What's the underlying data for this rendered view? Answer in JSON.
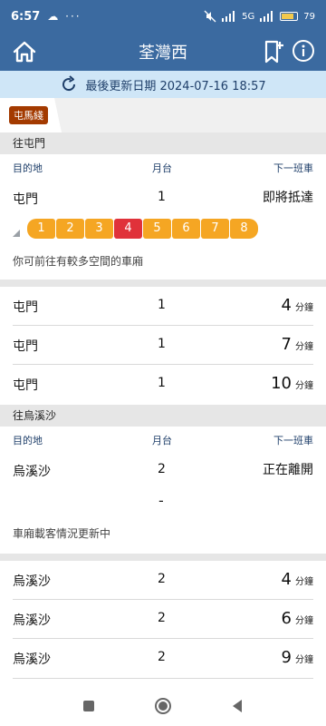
{
  "status_bar": {
    "time": "6:57",
    "left_icons": "☁ ···",
    "signal_text": "5G",
    "battery_text": "79"
  },
  "header": {
    "title": "荃灣西",
    "home_icon": "home-icon",
    "bookmark_icon": "bookmark-add-icon",
    "info_icon": "info-icon"
  },
  "update_bar": {
    "label": "最後更新日期 2024-07-16 18:57",
    "icon": "refresh-icon"
  },
  "line_tab": {
    "label": "屯馬綫",
    "color": "#a33a00"
  },
  "columns": {
    "destination": "目的地",
    "platform": "月台",
    "next_train": "下一班車"
  },
  "sections": [
    {
      "title": "往屯門",
      "first": {
        "destination": "屯門",
        "platform": "1",
        "status": "即將抵達"
      },
      "cars": [
        "1",
        "2",
        "3",
        "4",
        "5",
        "6",
        "7",
        "8"
      ],
      "busy_car_index": 3,
      "note": "你可前往有較多空間的車廂",
      "rows": [
        {
          "destination": "屯門",
          "platform": "1",
          "minutes": "4",
          "unit": "分鐘"
        },
        {
          "destination": "屯門",
          "platform": "1",
          "minutes": "7",
          "unit": "分鐘"
        },
        {
          "destination": "屯門",
          "platform": "1",
          "minutes": "10",
          "unit": "分鐘"
        }
      ]
    },
    {
      "title": "往烏溪沙",
      "first": {
        "destination": "烏溪沙",
        "platform": "2",
        "status": "正在離開"
      },
      "dash": "-",
      "note": "車廂載客情況更新中",
      "rows": [
        {
          "destination": "烏溪沙",
          "platform": "2",
          "minutes": "4",
          "unit": "分鐘"
        },
        {
          "destination": "烏溪沙",
          "platform": "2",
          "minutes": "6",
          "unit": "分鐘"
        },
        {
          "destination": "烏溪沙",
          "platform": "2",
          "minutes": "9",
          "unit": "分鐘"
        }
      ]
    }
  ],
  "colors": {
    "header": "#3b6aa0",
    "update_bar": "#cfe6f7",
    "car": "#f5a623",
    "car_busy": "#e0323a"
  }
}
